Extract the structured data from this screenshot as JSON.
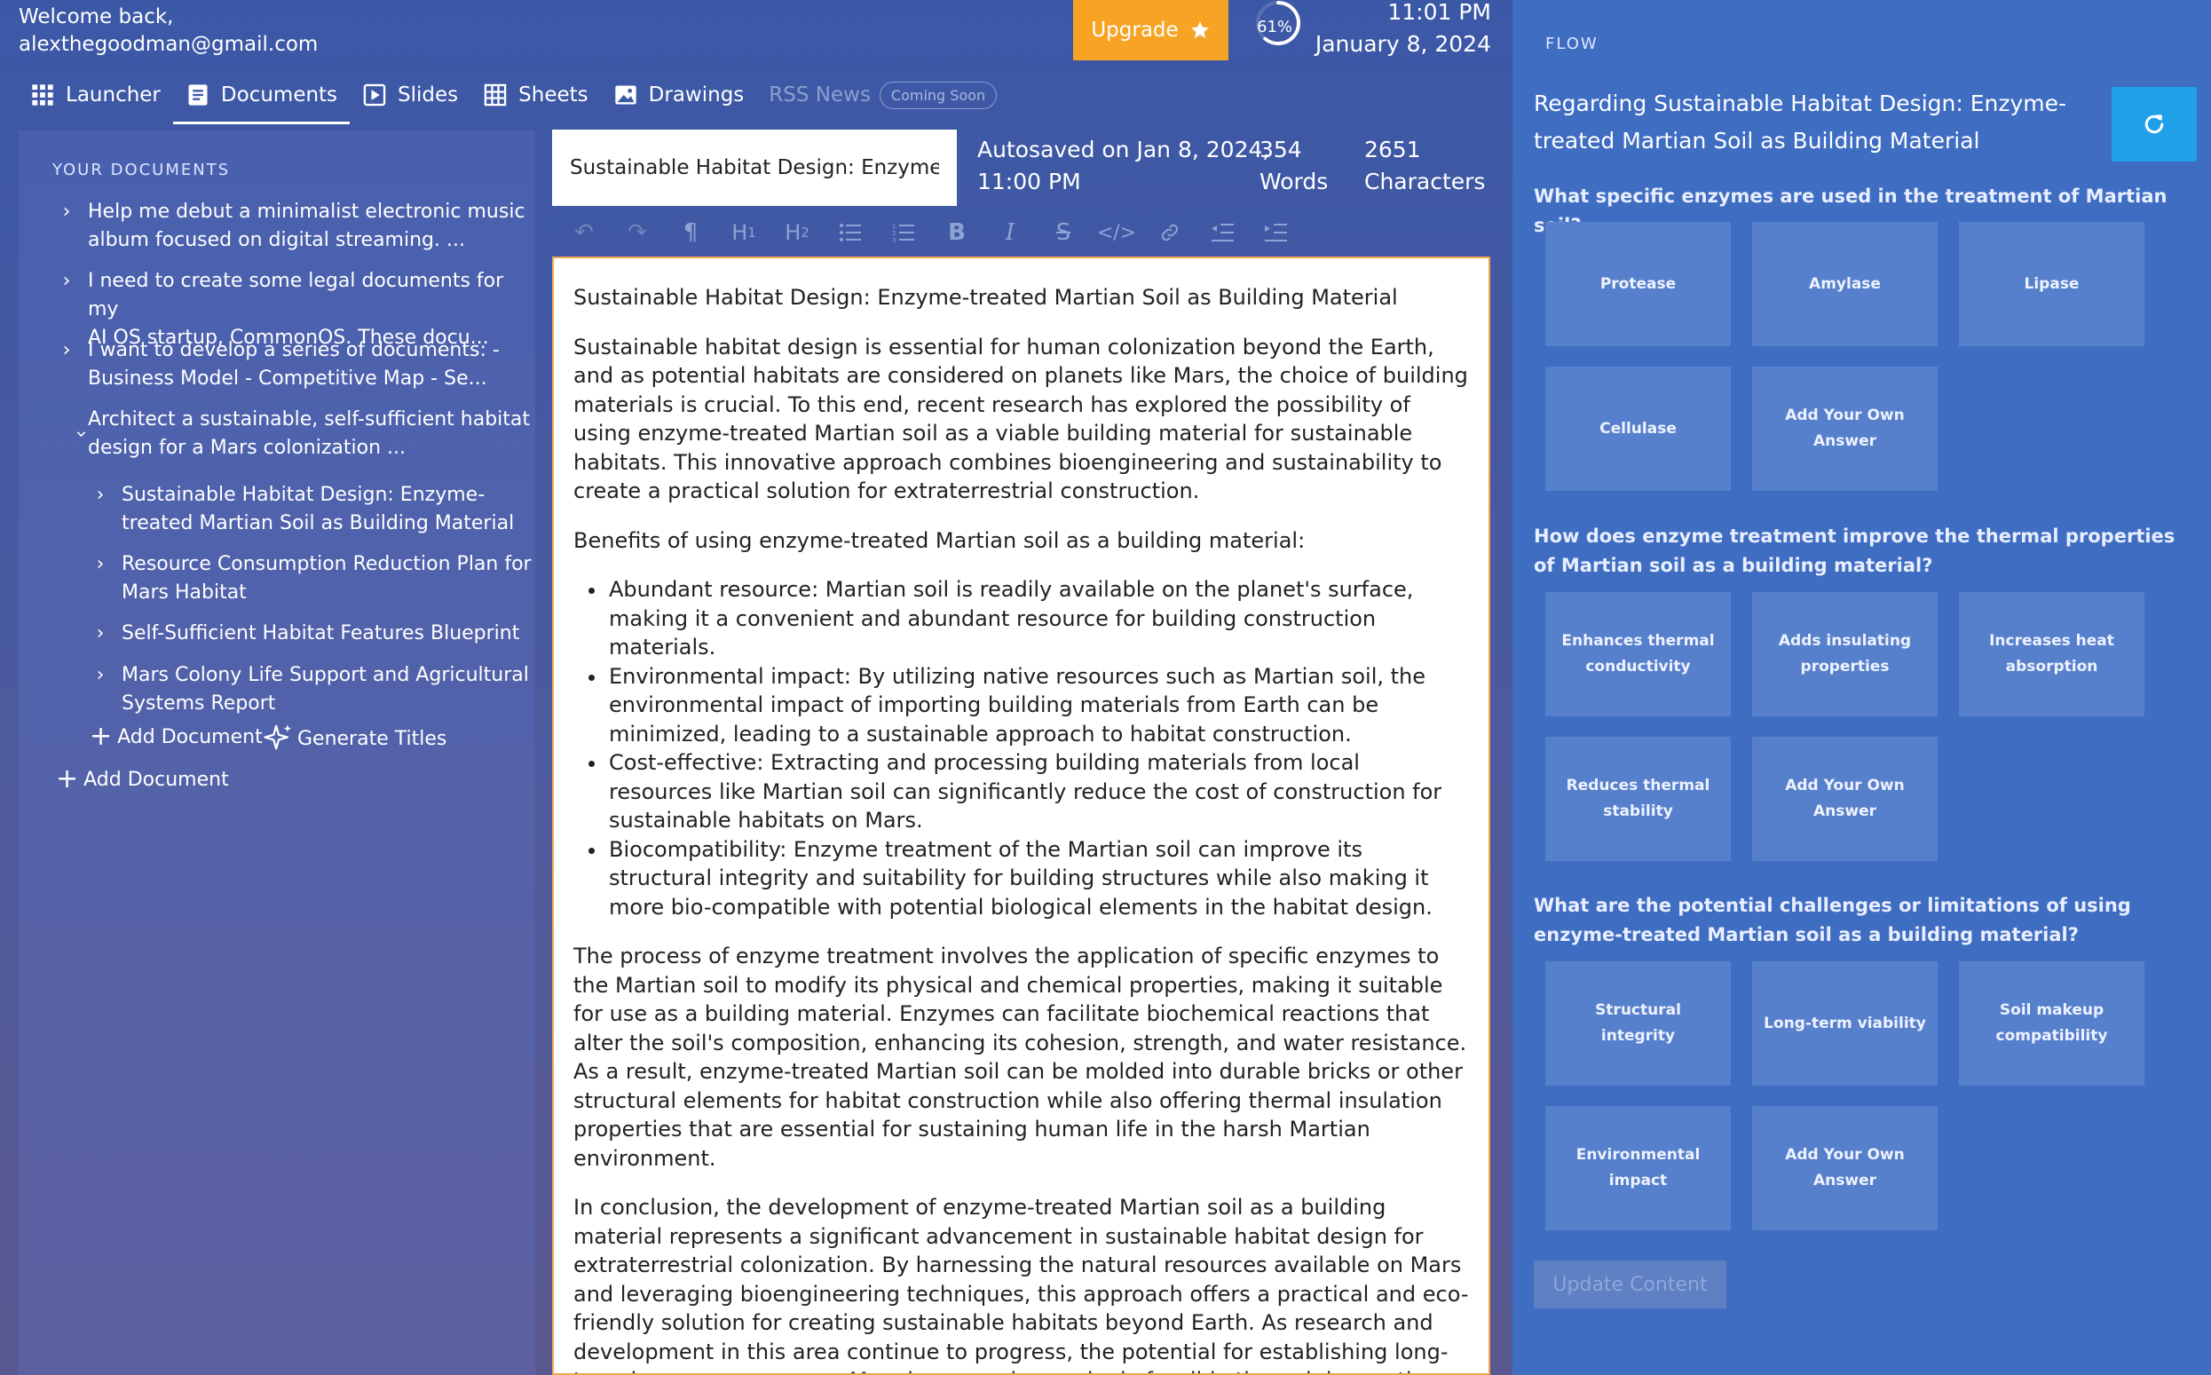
{
  "user": {
    "greeting": "Welcome back,",
    "email": "alexthegoodman@gmail.com"
  },
  "nav": {
    "items": [
      {
        "label": "Launcher",
        "icon": "grid-icon"
      },
      {
        "label": "Documents",
        "icon": "document-icon",
        "active": true
      },
      {
        "label": "Slides",
        "icon": "play-slides-icon"
      },
      {
        "label": "Sheets",
        "icon": "table-icon"
      },
      {
        "label": "Drawings",
        "icon": "image-icon"
      },
      {
        "label": "RSS News",
        "disabled": true,
        "badge": "Coming Soon"
      }
    ]
  },
  "upgrade": {
    "label": "Upgrade",
    "icon": "star-icon",
    "color": "#f7a424"
  },
  "progress": {
    "label": "61%",
    "value": 0.61
  },
  "clock": {
    "time": "11:01 PM",
    "date": "January 8, 2024"
  },
  "sidebar": {
    "heading": "YOUR DOCUMENTS",
    "documents": [
      {
        "lines": [
          "Help me debut a minimalist electronic music",
          "album focused on digital streaming. ..."
        ],
        "expanded": false
      },
      {
        "lines": [
          "I need to create some legal documents for my",
          "AI OS startup, CommonOS. These docu..."
        ],
        "expanded": false
      },
      {
        "lines": [
          "I want to develop a series of documents: -",
          "Business Model - Competitive Map - Se..."
        ],
        "expanded": false
      },
      {
        "lines": [
          "Architect a sustainable, self-sufficient habitat",
          "design for a Mars colonization ..."
        ],
        "expanded": true
      }
    ],
    "children": [
      {
        "lines": [
          "Sustainable Habitat Design: Enzyme-",
          "treated Martian Soil as Building Material"
        ]
      },
      {
        "lines": [
          "Resource Consumption Reduction Plan for",
          "Mars Habitat"
        ]
      },
      {
        "lines": [
          "Self-Sufficient Habitat Features Blueprint"
        ]
      },
      {
        "lines": [
          "Mars Colony Life Support and Agricultural",
          "Systems Report"
        ]
      }
    ],
    "add_document_child": "Add Document",
    "generate_titles": "Generate Titles",
    "add_document": "Add Document"
  },
  "editor": {
    "title_value": "Sustainable Habitat Design: Enzyme-treated Martian Soil as Building Material",
    "autosave_lines": [
      "Autosaved on Jan 8, 2024,",
      "11:00 PM"
    ],
    "words": {
      "count": "354",
      "label": "Words"
    },
    "characters": {
      "count": "2651",
      "label": "Characters"
    },
    "toolbar": [
      "undo-icon",
      "redo-icon",
      "paragraph-icon",
      "heading1-icon",
      "heading2-icon",
      "bullet-list-icon",
      "ordered-list-icon",
      "bold-icon",
      "italic-icon",
      "strikethrough-icon",
      "code-icon",
      "link-icon",
      "outdent-icon",
      "indent-icon"
    ],
    "heading": "Sustainable Habitat Design: Enzyme-treated Martian Soil as Building Material",
    "intro": "Sustainable habitat design is essential for human colonization beyond the Earth, and as potential habitats are considered on planets like Mars, the choice of building materials is crucial. To this end, recent research has explored the possibility of using enzyme-treated Martian soil as a viable building material for sustainable habitats. This innovative approach combines bioengineering and sustainability to create a practical solution for extraterrestrial construction.",
    "benefits_heading": "Benefits of using enzyme-treated Martian soil as a building material:",
    "benefits": [
      "Abundant resource: Martian soil is readily available on the planet's surface, making it a convenient and abundant resource for building construction materials.",
      "Environmental impact: By utilizing native resources such as Martian soil, the environmental impact of importing building materials from Earth can be minimized, leading to a sustainable approach to habitat construction.",
      "Cost-effective: Extracting and processing building materials from local resources like Martian soil can significantly reduce the cost of construction for sustainable habitats on Mars.",
      "Biocompatibility: Enzyme treatment of the Martian soil can improve its structural integrity and suitability for building structures while also making it more bio-compatible with potential biological elements in the habitat design."
    ],
    "process": "The process of enzyme treatment involves the application of specific enzymes to the Martian soil to modify its physical and chemical properties, making it suitable for use as a building material. Enzymes can facilitate biochemical reactions that alter the soil's composition, enhancing its cohesion, strength, and water resistance. As a result, enzyme-treated Martian soil can be molded into durable bricks or other structural elements for habitat construction while also offering thermal insulation properties that are essential for sustaining human life in the harsh Martian environment.",
    "conclusion": "In conclusion, the development of enzyme-treated Martian soil as a building material represents a significant advancement in sustainable habitat design for extraterrestrial colonization. By harnessing the natural resources available on Mars and leveraging bioengineering techniques, this approach offers a practical and eco-friendly solution for creating sustainable habitats beyond Earth. As research and development in this area continue to progress, the potential for establishing long-term human presence on Mars becomes increasingly feasible through innovative approaches like enzyme-treated Martian soil as a building material."
  },
  "flow": {
    "label": "FLOW",
    "title": "Regarding Sustainable Habitat Design: Enzyme-treated Martian Soil as Building Material",
    "refresh_icon": "refresh-icon",
    "questions": [
      {
        "text": "What specific enzymes are used in the treatment of Martian soil?",
        "options": [
          "Protease",
          "Amylase",
          "Lipase",
          "Cellulase",
          "Add Your Own Answer"
        ]
      },
      {
        "text": "How does enzyme treatment improve the thermal properties of Martian soil as a building material?",
        "options": [
          "Enhances thermal conductivity",
          "Adds insulating properties",
          "Increases heat absorption",
          "Reduces thermal stability",
          "Add Your Own Answer"
        ]
      },
      {
        "text": "What are the potential challenges or limitations of using enzyme-treated Martian soil as a building material?",
        "options": [
          "Structural integrity",
          "Long-term viability",
          "Soil makeup compatibility",
          "Environmental impact",
          "Add Your Own Answer"
        ]
      }
    ],
    "update_button": "Update Content"
  }
}
